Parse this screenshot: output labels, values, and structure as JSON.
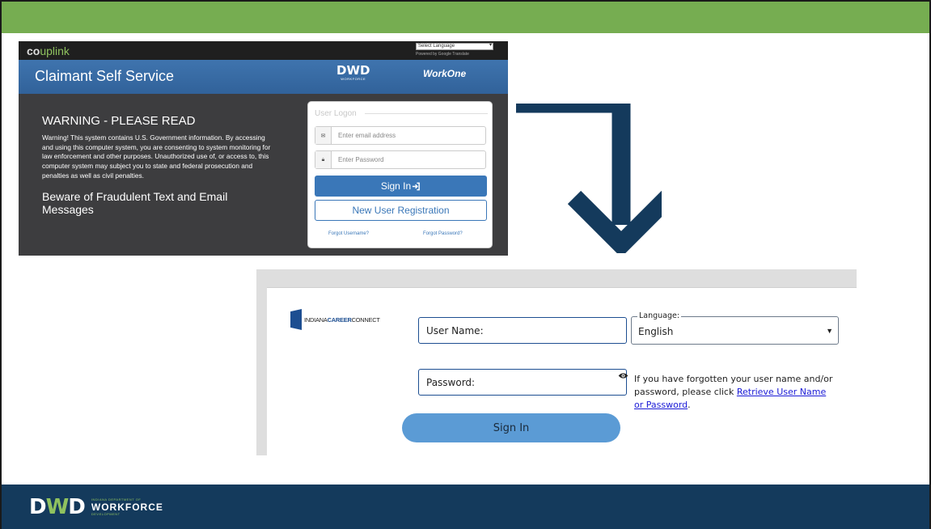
{
  "uplink": {
    "logo_co": "co",
    "logo_up": "uplink",
    "language_select": "Select Language",
    "google_translate": "Powered by Google Translate",
    "header_title": "Claimant Self Service",
    "dwd_mark": "DWD",
    "dwd_tagline": "WORKFORCE",
    "workone": "WorkOne",
    "warning_title": "WARNING - PLEASE READ",
    "warning_text": "Warning! This system contains U.S. Government information. By accessing and using this computer system, you are consenting to system monitoring for law enforcement and other purposes. Unauthorized use of, or access to, this computer system may subject you to state and federal prosecution and penalties as well as civil penalties.",
    "fraud_title": "Beware of Fraudulent Text and Email Messages",
    "logon_legend": "User Logon",
    "email_placeholder": "Enter email address",
    "password_placeholder": "Enter Password",
    "signin_label": "Sign In",
    "new_user_label": "New User Registration",
    "forgot_username": "Forgot Username?",
    "forgot_password": "Forgot Password?"
  },
  "icc": {
    "logo_indiana": "INDIANA",
    "logo_career": "CAREER",
    "logo_connect": "CONNECT",
    "username_label": "User Name:",
    "password_label": "Password:",
    "language_label": "Language:",
    "language_value": "English",
    "forgot_text": "If you have forgotten your user name and/or password, please click",
    "forgot_link": "Retrieve User Name or Password",
    "forgot_end": ".",
    "signin_label": "Sign In"
  },
  "footer": {
    "dwd_d1": "D",
    "dwd_w": "W",
    "dwd_d2": "D",
    "indiana_dept": "INDIANA DEPARTMENT OF",
    "workforce": "WORKFORCE",
    "development": "DEVELOPMENT"
  },
  "colors": {
    "top_bar": "#76ad51",
    "footer": "#143a5c",
    "arrow": "#143a5c",
    "uplink_blue": "#3a77b8",
    "icc_signin": "#5b9bd5"
  }
}
